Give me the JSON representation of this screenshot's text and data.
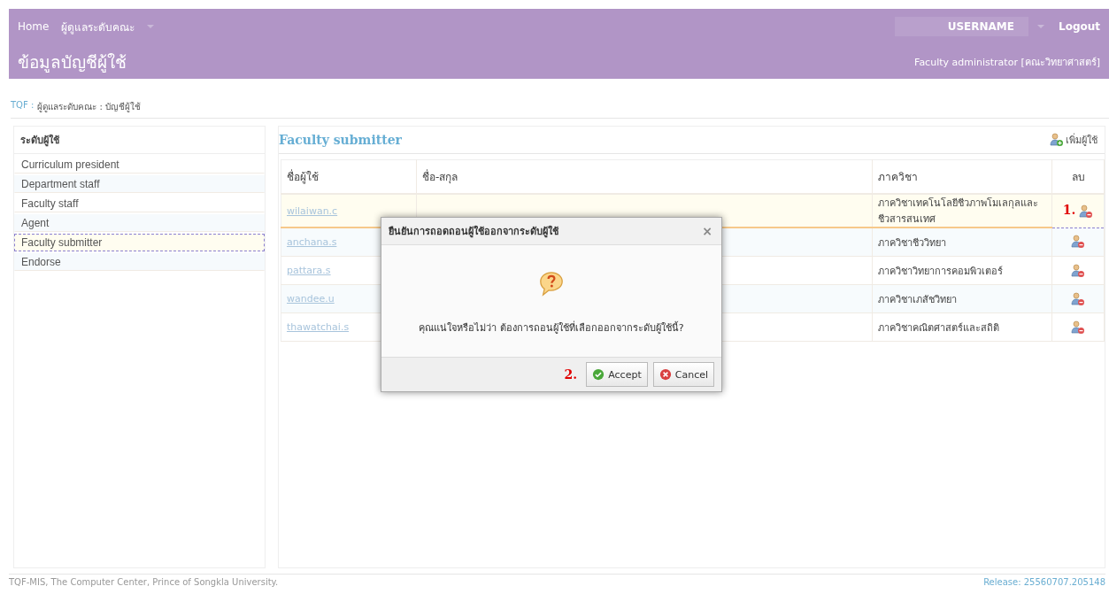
{
  "header": {
    "nav": [
      {
        "label": "Home",
        "dropdown": false
      },
      {
        "label": "ผู้ดูแลระดับคณะ",
        "dropdown": true
      }
    ],
    "user": {
      "name": "USERNAME",
      "dropdown": true
    },
    "logout": "Logout",
    "page_title": "ข้อมูลบัญชีผู้ใช้",
    "role": "Faculty administrator [คณะวิทยาศาสตร์]"
  },
  "breadcrumb": [
    {
      "text": "TQF :",
      "kind": "link"
    },
    {
      "text": "ผู้ดูแลระดับคณะ : บัญชีผู้ใช้",
      "kind": "text"
    }
  ],
  "sidebar": {
    "title": "ระดับผู้ใช้",
    "items": [
      {
        "label": "Curriculum president",
        "selected": false
      },
      {
        "label": "Department staff",
        "selected": false
      },
      {
        "label": "Faculty staff",
        "selected": false
      },
      {
        "label": "Agent",
        "selected": false
      },
      {
        "label": "Faculty submitter",
        "selected": true
      },
      {
        "label": "Endorse",
        "selected": false
      }
    ]
  },
  "main": {
    "title": "Faculty submitter",
    "add_button": "เพิ่มผู้ใช้",
    "table": {
      "columns": [
        "ชื่อผู้ใช้",
        "ชื่อ-สกุล",
        "ภาควิชา",
        "ลบ"
      ],
      "rows": [
        {
          "username": "wilaiwan.c",
          "department": "ภาควิชาเทคโนโลยีชีวภาพโมเลกุลและชีวสารสนเทศ",
          "selected": true,
          "marker": "1."
        },
        {
          "username": "anchana.s",
          "department": "ภาควิชาชีววิทยา",
          "selected": false
        },
        {
          "username": "pattara.s",
          "department": "ภาควิชาวิทยาการคอมพิวเตอร์",
          "selected": false
        },
        {
          "username": "wandee.u",
          "department": "ภาควิชาเภสัชวิทยา",
          "selected": false
        },
        {
          "username": "thawatchai.s",
          "department": "ภาควิชาคณิตศาสตร์และสถิติ",
          "selected": false
        }
      ]
    }
  },
  "dialog": {
    "title": "ยืนยันการถอดถอนผู้ใช้ออกจากระดับผู้ใช้",
    "close": "×",
    "message": "คุณแน่ใจหรือไม่ว่า ต้องการถอนผู้ใช้ที่เลือกออกจากระดับผู้ใช้นี้?",
    "marker": "2.",
    "buttons": [
      {
        "label": "Accept",
        "kind": "accept"
      },
      {
        "label": "Cancel",
        "kind": "cancel"
      }
    ]
  },
  "footer": {
    "left": "TQF-MIS, The Computer Center, Prince of Songkla University.",
    "right": "Release: 25560707.205148"
  }
}
